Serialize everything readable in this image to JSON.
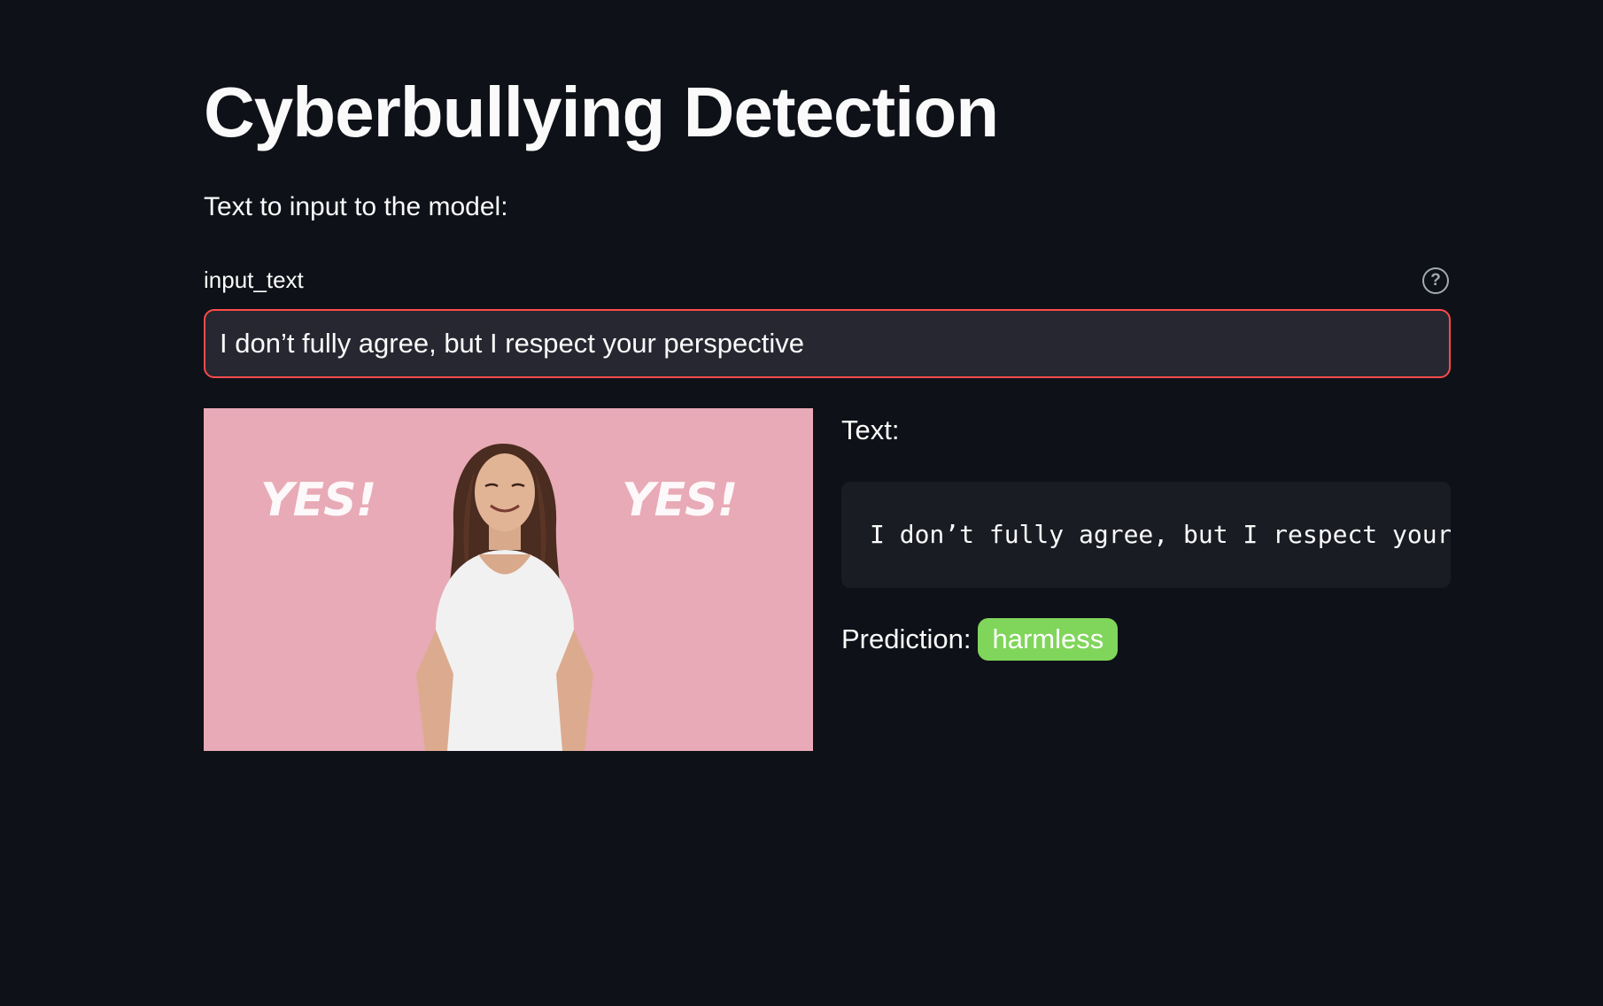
{
  "app": {
    "title": "Cyberbullying Detection",
    "intro": "Text to input to the model:"
  },
  "input": {
    "label": "input_text",
    "value": "I don’t fully agree, but I respect your perspective",
    "help_icon": "question-circle-icon"
  },
  "media": {
    "gif_caption_left": "YES!",
    "gif_caption_right": "YES!"
  },
  "result": {
    "text_label": "Text:",
    "text_value": "I don’t fully agree, but I respect your perspective",
    "prediction_label": "Prediction:",
    "prediction_value": "harmless",
    "prediction_color": "#80d65a"
  },
  "theme": {
    "background": "#0e1117",
    "input_background": "#262730",
    "input_focus_border": "#ff4b4b",
    "code_background": "#1a1c24",
    "gif_background": "#e8aab6"
  }
}
